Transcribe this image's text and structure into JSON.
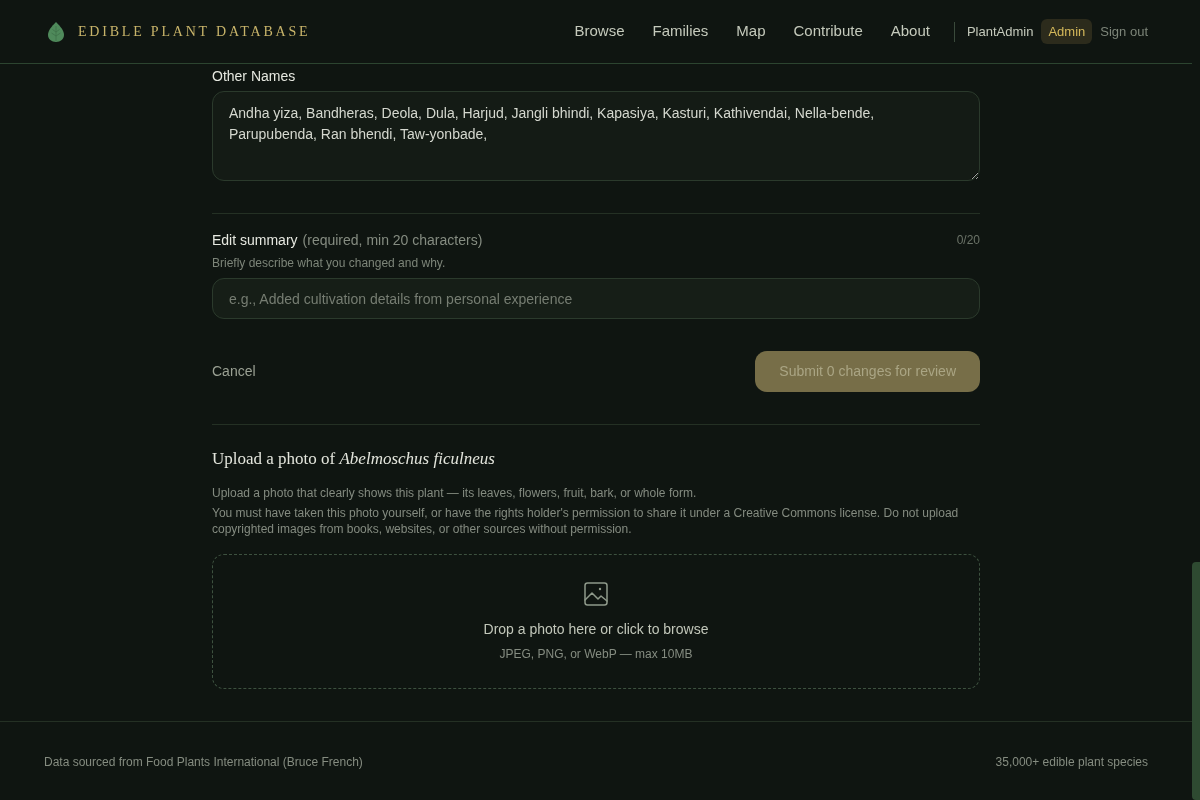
{
  "header": {
    "site_title": "EDIBLE PLANT DATABASE",
    "nav": [
      {
        "label": "Browse"
      },
      {
        "label": "Families"
      },
      {
        "label": "Map"
      },
      {
        "label": "Contribute"
      },
      {
        "label": "About"
      }
    ],
    "user": {
      "name": "PlantAdmin",
      "role": "Admin",
      "sign_out": "Sign out"
    }
  },
  "other_names": {
    "label": "Other Names",
    "value": "Andha yiza, Bandheras, Deola, Dula, Harjud, Jangli bhindi, Kapasiya, Kasturi, Kathivendai, Nella-bende, Parupubenda, Ran bhendi, Taw-yonbade,"
  },
  "edit_summary": {
    "label": "Edit summary",
    "requirement": "(required, min 20 characters)",
    "counter": "0/20",
    "hint": "Briefly describe what you changed and why.",
    "placeholder": "e.g., Added cultivation details from personal experience"
  },
  "actions": {
    "cancel": "Cancel",
    "submit": {
      "label": "Submit 0 changes for review",
      "disabled": true
    }
  },
  "upload": {
    "heading": "Upload a photo of *Abelmoschus ficulneus*",
    "paragraphs": [
      "Upload a photo that clearly shows this plant — its leaves, flowers, fruit, bark, or whole form.",
      "You must have taken this photo yourself, or have the rights holder's permission to share it under a Creative Commons license. Do not upload copyrighted images from books, websites, or other sources without permission."
    ],
    "dropzone": {
      "title": "Drop a photo here or click to browse",
      "formats": "JPEG, PNG, or WebP — max 10MB"
    }
  },
  "footer": {
    "source": "Data sourced from Food Plants International (Bruce French)",
    "species_count": "35,000+ edible plant species"
  }
}
